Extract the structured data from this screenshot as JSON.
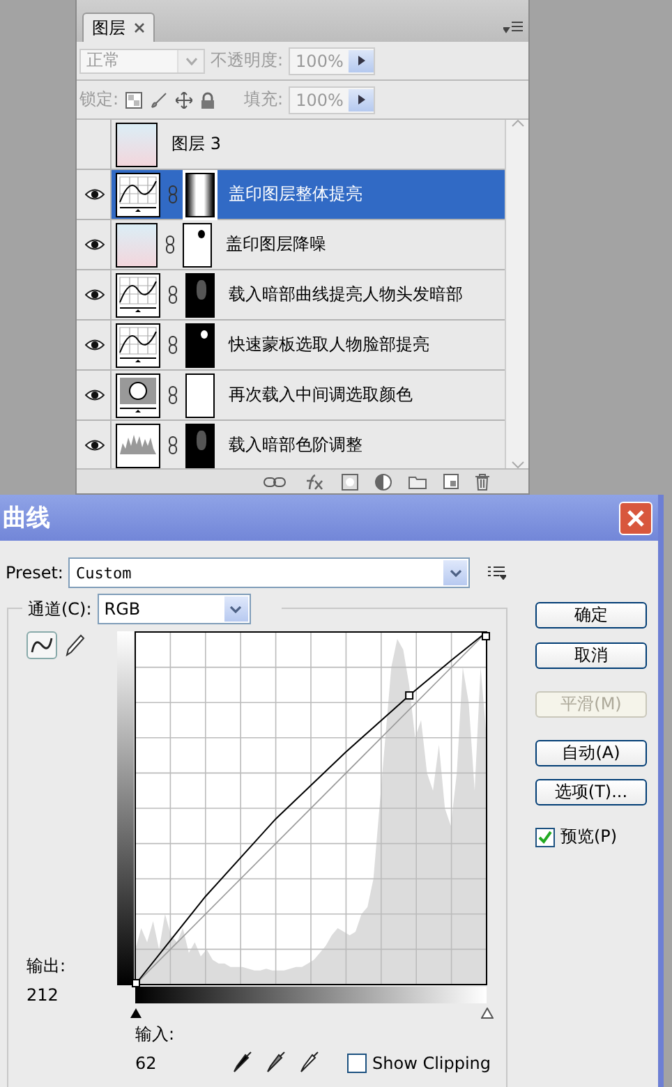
{
  "layers_panel": {
    "tab": "图层",
    "blend_mode": "正常",
    "opacity_label": "不透明度:",
    "opacity": "100%",
    "lock_label": "锁定:",
    "fill_label": "填充:",
    "fill": "100%",
    "layers": [
      {
        "name": "图层 3",
        "visible": false,
        "selected": false,
        "thumb": {
          "kind": "photo"
        }
      },
      {
        "name": "盖印图层整体提亮",
        "visible": true,
        "selected": true,
        "thumb": {
          "kind": "curves"
        },
        "mask": {
          "kind": "gradient"
        }
      },
      {
        "name": "盖印图层降噪",
        "visible": true,
        "selected": false,
        "thumb": {
          "kind": "photo"
        },
        "mask": {
          "kind": "silhouette"
        }
      },
      {
        "name": "载入暗部曲线提亮人物头发暗部",
        "visible": true,
        "selected": false,
        "thumb": {
          "kind": "curves"
        },
        "mask": {
          "kind": "dark"
        }
      },
      {
        "name": "快速蒙板选取人物脸部提亮",
        "visible": true,
        "selected": false,
        "thumb": {
          "kind": "curves"
        },
        "mask": {
          "kind": "spot"
        }
      },
      {
        "name": "再次载入中间调选取颜色",
        "visible": true,
        "selected": false,
        "thumb": {
          "kind": "selective"
        },
        "mask": {
          "kind": "white"
        }
      },
      {
        "name": "载入暗部色阶调整",
        "visible": true,
        "selected": false,
        "thumb": {
          "kind": "levels"
        },
        "mask": {
          "kind": "dark"
        }
      }
    ]
  },
  "dialog": {
    "title": "曲线",
    "preset_label": "Preset:",
    "preset": "Custom",
    "channel_label": "通道(C):",
    "channel": "RGB",
    "buttons": [
      {
        "label": "确定",
        "disabled": false
      },
      {
        "label": "取消",
        "disabled": false
      },
      {
        "label": "平滑(M)",
        "disabled": true
      },
      {
        "label": "自动(A)",
        "disabled": false
      },
      {
        "label": "选项(T)...",
        "disabled": false
      }
    ],
    "preview": {
      "label": "预览(P)",
      "checked": true
    },
    "output_label": "输出:",
    "output": "212",
    "shadow_slider": {
      "level": 0
    },
    "highlight_slider": {
      "level": 1
    },
    "input_label": "输入:",
    "input": "62",
    "show_clipping": {
      "label": "Show Clipping",
      "checked": false
    }
  }
}
